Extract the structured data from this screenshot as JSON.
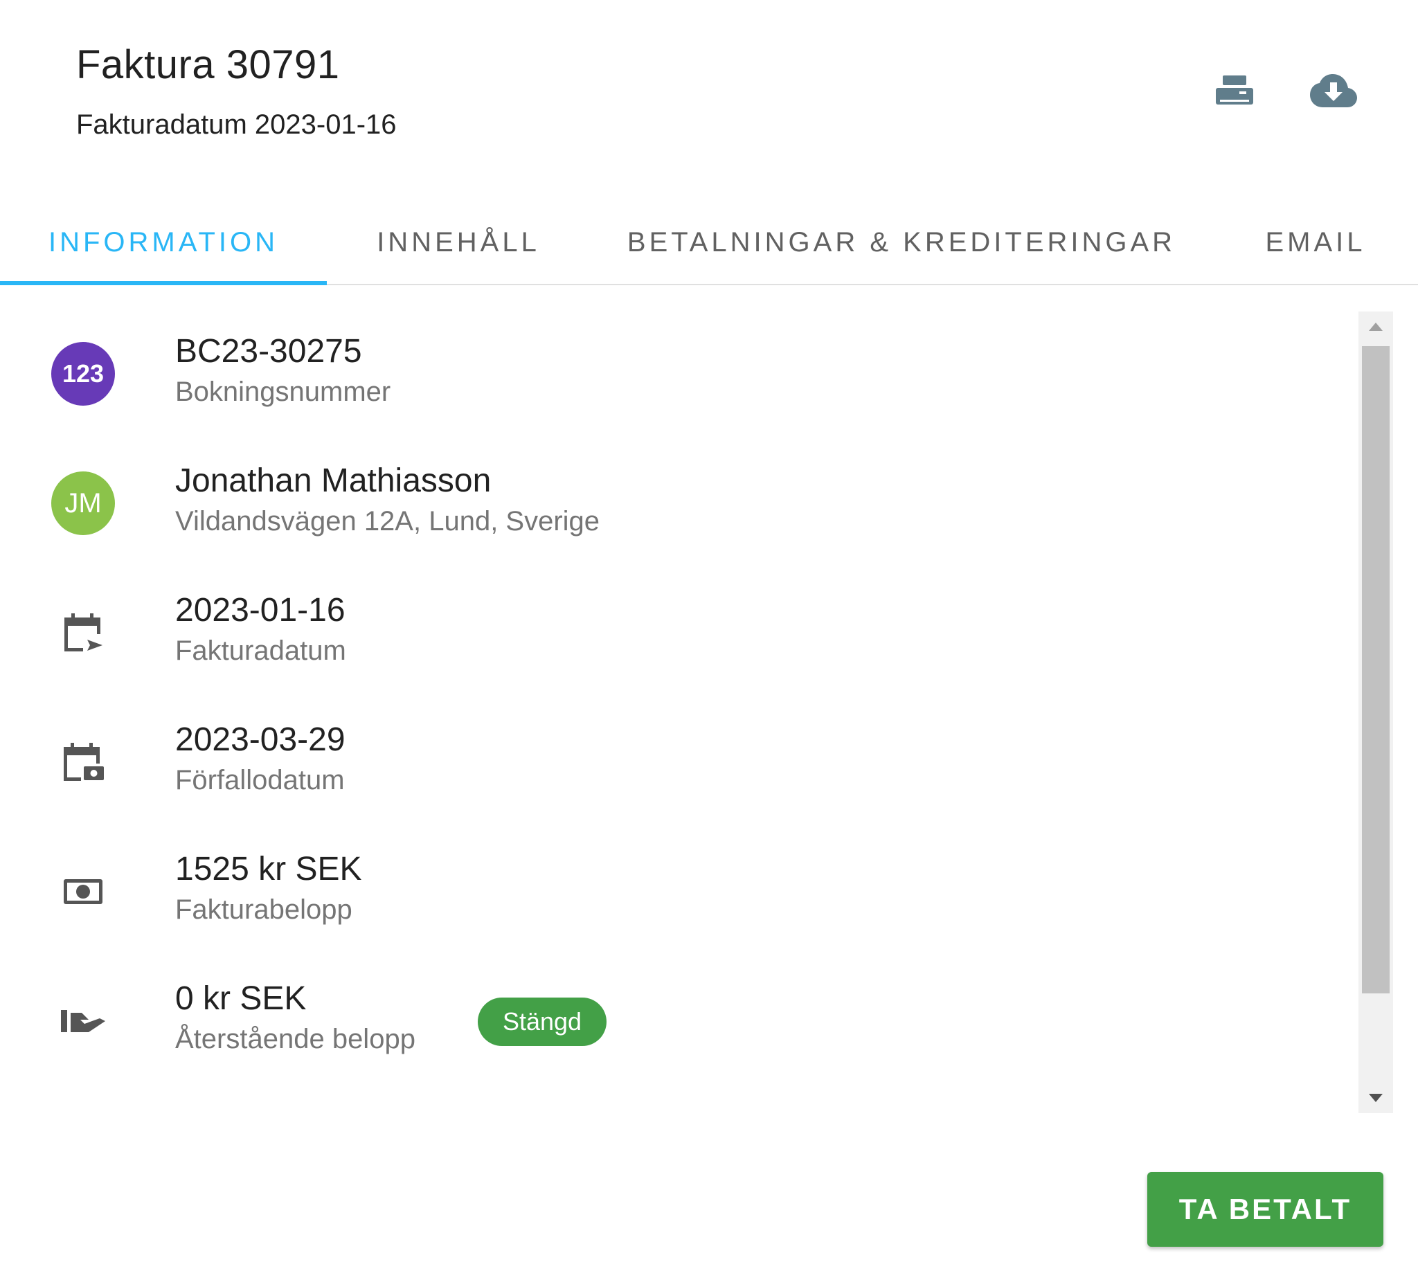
{
  "header": {
    "title": "Faktura 30791",
    "subtitle": "Fakturadatum 2023-01-16",
    "print_icon": "printer-icon",
    "download_icon": "cloud-download-icon"
  },
  "tabs": [
    {
      "label": "INFORMATION",
      "active": true
    },
    {
      "label": "INNEHÅLL",
      "active": false
    },
    {
      "label": "BETALNINGAR & KREDITERINGAR",
      "active": false
    },
    {
      "label": "EMAIL",
      "active": false
    }
  ],
  "rows": [
    {
      "icon": "numbers-avatar-icon",
      "avatar_text": "123",
      "primary": "BC23-30275",
      "secondary": "Bokningsnummer"
    },
    {
      "icon": "customer-avatar",
      "avatar_text": "JM",
      "primary": "Jonathan Mathiasson",
      "secondary": "Vildandsvägen 12A, Lund, Sverige"
    },
    {
      "icon": "calendar-send-icon",
      "primary": "2023-01-16",
      "secondary": "Fakturadatum"
    },
    {
      "icon": "calendar-money-icon",
      "primary": "2023-03-29",
      "secondary": "Förfallodatum"
    },
    {
      "icon": "cash-icon",
      "primary": "1525 kr SEK",
      "secondary": "Fakturabelopp"
    },
    {
      "icon": "hand-money-icon",
      "primary": "0 kr SEK",
      "secondary": "Återstående belopp",
      "badge": "Stängd"
    }
  ],
  "actions": {
    "pay_label": "TA BETALT"
  },
  "colors": {
    "accent": "#29b6f6",
    "success": "#43a047",
    "avatar_purple": "#673ab7",
    "avatar_green": "#8bc34a",
    "icon_grey": "#607d8b"
  }
}
